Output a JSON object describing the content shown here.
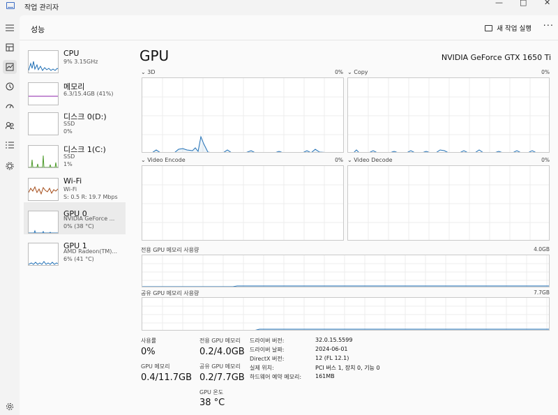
{
  "window": {
    "title": "작업 관리자",
    "controls": {
      "minimize": "—",
      "maximize": "□",
      "close": "✕"
    }
  },
  "nav": {
    "icons": [
      "hamburger-icon",
      "processes-icon",
      "performance-icon",
      "app-history-icon",
      "startup-icon",
      "users-icon",
      "details-icon",
      "services-icon",
      "settings-icon"
    ]
  },
  "header": {
    "title": "성능",
    "run_task": "새 작업 실행",
    "more": "···"
  },
  "sidebar": {
    "items": [
      {
        "name": "CPU",
        "line1": "9% 3.15GHz",
        "line2": "",
        "color": "#1f6fb5"
      },
      {
        "name": "메모리",
        "line1": "6.3/15.4GB (41%)",
        "line2": "",
        "color": "#8b1fa9"
      },
      {
        "name": "디스크 0(D:)",
        "line1": "SSD",
        "line2": "0%",
        "color": "#4c9a2a"
      },
      {
        "name": "디스크 1(C:)",
        "line1": "SSD",
        "line2": "1%",
        "color": "#4c9a2a"
      },
      {
        "name": "Wi-Fi",
        "line1": "Wi-Fi",
        "line2": "S: 0.5  R: 19.7 Mbps",
        "color": "#a54d1a"
      },
      {
        "name": "GPU 0",
        "line1": "NVIDIA GeForce ...",
        "line2": "0% (38 °C)",
        "color": "#1f6fb5"
      },
      {
        "name": "GPU 1",
        "line1": "AMD Radeon(TM)...",
        "line2": "6% (41 °C)",
        "color": "#1f6fb5"
      }
    ]
  },
  "gpu": {
    "title": "GPU",
    "model": "NVIDIA GeForce GTX 1650 Ti",
    "graphs": {
      "g3d": {
        "label": "3D",
        "pct": "0%"
      },
      "copy": {
        "label": "Copy",
        "pct": "0%"
      },
      "encode": {
        "label": "Video Encode",
        "pct": "0%"
      },
      "decode": {
        "label": "Video Decode",
        "pct": "0%"
      },
      "dedicated": {
        "label": "전용 GPU 메모리 사용량",
        "max": "4.0GB"
      },
      "shared": {
        "label": "공유 GPU 메모리 사용량",
        "max": "7.7GB"
      }
    },
    "stats": {
      "usage_label": "사용률",
      "usage_value": "0%",
      "gpu_mem_label": "GPU 메모리",
      "gpu_mem_value": "0.4/11.7GB",
      "dedicated_label": "전용 GPU 메모리",
      "dedicated_value": "0.2/4.0GB",
      "shared_label": "공유 GPU 메모리",
      "shared_value": "0.2/7.7GB",
      "temp_label": "GPU 온도",
      "temp_value": "38 °C"
    },
    "details": [
      {
        "key": "드라이버 버전:",
        "value": "32.0.15.5599"
      },
      {
        "key": "드라이버 날짜:",
        "value": "2024-06-01"
      },
      {
        "key": "DirectX 버전:",
        "value": "12 (FL 12.1)"
      },
      {
        "key": "실제 위치:",
        "value": "PCI 버스 1, 장치 0, 기능 0"
      },
      {
        "key": "하드웨어 예약 메모리:",
        "value": "161MB"
      }
    ]
  },
  "colors": {
    "graph_line": "#1f6fb5",
    "memory_line": "#8b1fa9",
    "disk_line": "#4c9a2a",
    "wifi_line": "#a54d1a",
    "selected_bg": "#ebebeb"
  }
}
